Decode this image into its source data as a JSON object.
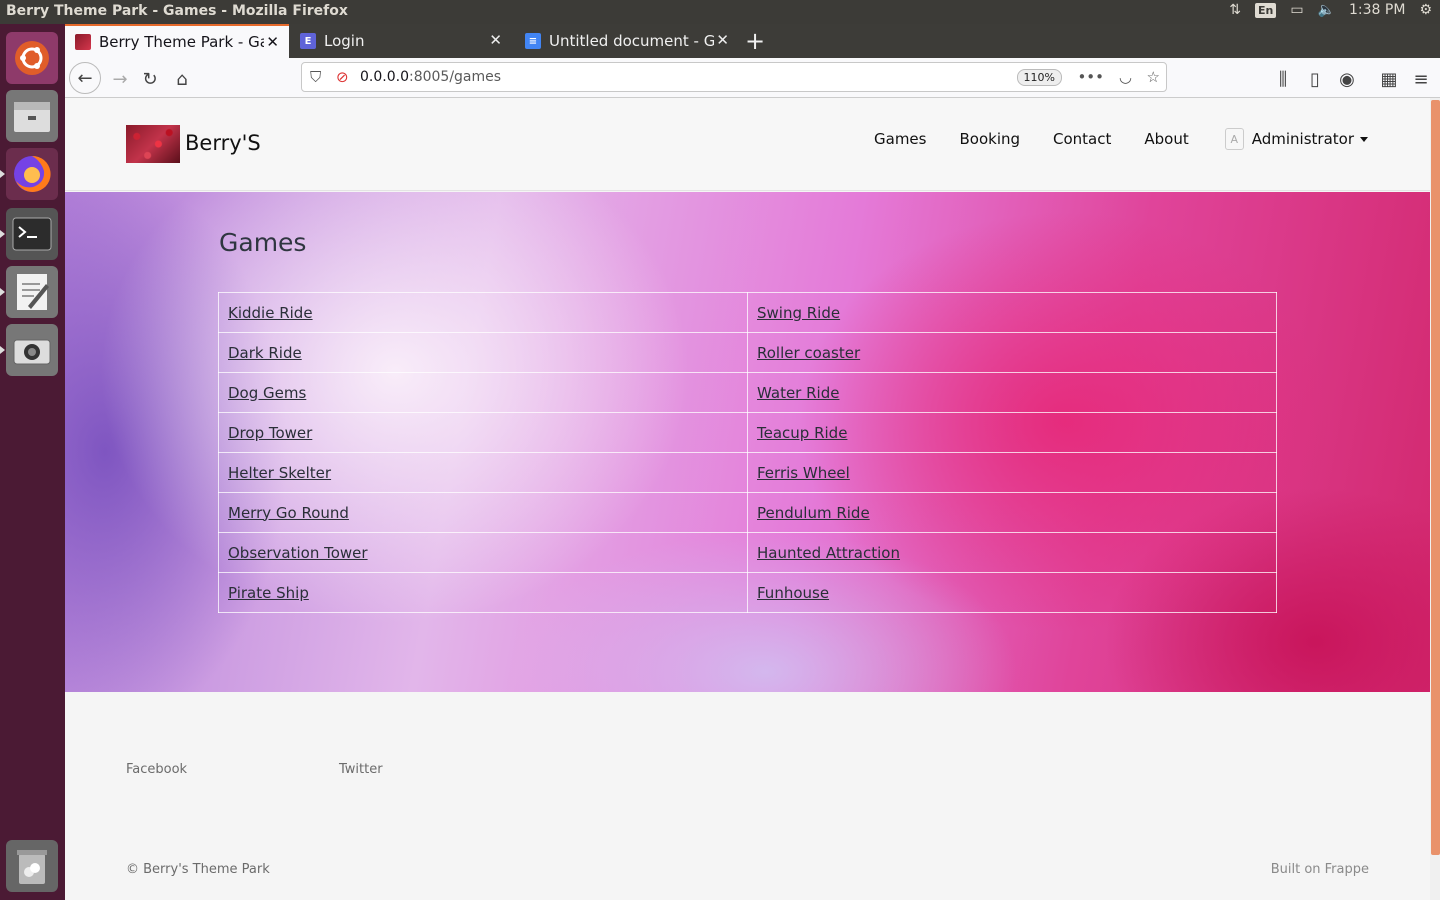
{
  "os": {
    "window_title": "Berry Theme Park - Games - Mozilla Firefox",
    "lang": "En",
    "time": "1:38 PM"
  },
  "browser": {
    "tabs": [
      {
        "label": "Berry Theme Park - Games"
      },
      {
        "label": "Login"
      },
      {
        "label": "Untitled document - Google Docs"
      }
    ],
    "url_host": "0.0.0.0",
    "url_path": ":8005/games",
    "zoom": "110%"
  },
  "site": {
    "brand": "Berry'S",
    "nav": {
      "games": "Games",
      "booking": "Booking",
      "contact": "Contact",
      "about": "About",
      "avatar_letter": "A",
      "user": "Administrator"
    },
    "page_title": "Games",
    "games": [
      [
        "Kiddie Ride",
        "Swing Ride"
      ],
      [
        "Dark Ride",
        "Roller coaster"
      ],
      [
        "Dog Gems",
        "Water Ride"
      ],
      [
        "Drop Tower",
        "Teacup Ride"
      ],
      [
        "Helter Skelter",
        "Ferris Wheel"
      ],
      [
        "Merry Go Round",
        "Pendulum Ride"
      ],
      [
        "Observation Tower",
        "Haunted Attraction"
      ],
      [
        "Pirate Ship",
        "Funhouse"
      ]
    ],
    "footer": {
      "facebook": "Facebook",
      "twitter": "Twitter",
      "copyright": "© Berry's Theme Park",
      "built": "Built on Frappe"
    }
  },
  "colors": {
    "accent_tab": "#e66a2c",
    "launcher_bg": "#4b1a34"
  }
}
